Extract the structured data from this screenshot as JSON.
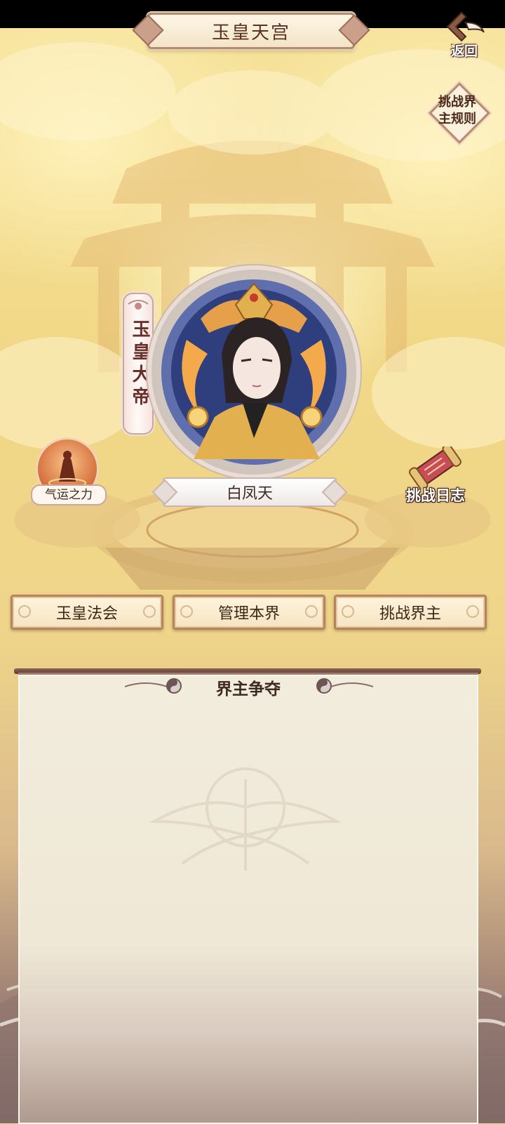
{
  "header": {
    "title": "玉皇天宫",
    "back_label": "返回"
  },
  "rules_button": {
    "line1": "挑战界",
    "line2": "主规则"
  },
  "realm_lord": {
    "rank": "玉皇大帝",
    "name": "白凤天"
  },
  "side_buttons": {
    "fortune_label": "气运之力",
    "log_label": "挑战日志"
  },
  "actions": [
    {
      "label": "玉皇法会"
    },
    {
      "label": "管理本界"
    },
    {
      "label": "挑战界主"
    }
  ],
  "panel": {
    "title": "界主争夺"
  },
  "colors": {
    "accent_brown": "#b7835f",
    "title_text": "#5a3220",
    "sky_gold": "#f1d887"
  }
}
